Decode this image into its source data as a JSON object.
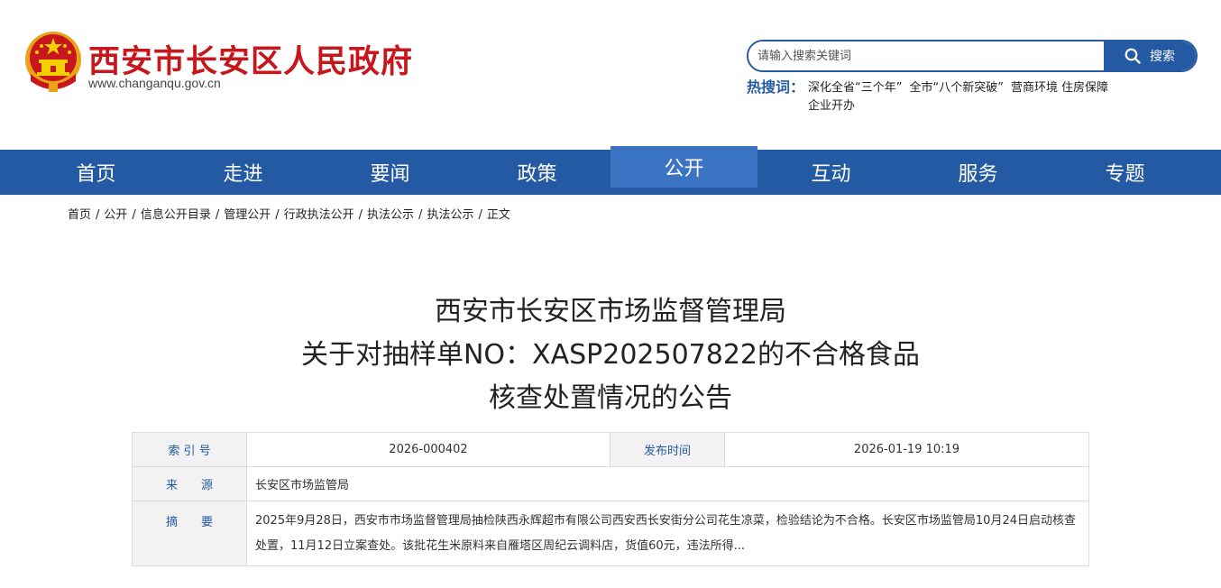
{
  "header": {
    "site_title": "西安市长安区人民政府",
    "site_url": "www.changanqu.gov.cn",
    "colors": {
      "brand_red": "#c8161d",
      "brand_blue": "#2459a3"
    }
  },
  "search": {
    "placeholder": "请输入搜索关键词",
    "button_label": "搜索",
    "icon": "search-icon"
  },
  "hot_search": {
    "label": "热搜词：",
    "links": [
      "深化全省“三个年”",
      "全市“八个新突破”",
      "营商环境",
      "住房保障",
      "企业开办"
    ]
  },
  "nav": {
    "items": [
      "首页",
      "走进",
      "要闻",
      "政策",
      "公开",
      "互动",
      "服务",
      "专题"
    ],
    "active": "公开"
  },
  "breadcrumb": [
    "首页",
    "公开",
    "信息公开目录",
    "管理公开",
    "行政执法公开",
    "执法公示",
    "执法公示",
    "正文"
  ],
  "breadcrumb_sep": "/",
  "document": {
    "title_lines": [
      "西安市长安区市场监督管理局",
      "关于对抽样单NO：XASP202507822的不合格食品",
      "核查处置情况的公告"
    ],
    "info": {
      "index_label": "索 引 号",
      "index_value": "2026-000402",
      "date_label": "发布时间",
      "date_value": "2026-01-19 10:19",
      "source_label": "来　　源",
      "source_value": "长安区市场监管局",
      "summary_label": "摘　　要",
      "summary_value": "2025年9月28日，西安市市场监督管理局抽检陕西永辉超市有限公司西安西长安街分公司花生凉菜，检验结论为不合格。长安区市场监管局10月24日启动核查处置，11月12日立案查处。该批花生米原料来自雁塔区周纪云调料店，货值60元，违法所得..."
    }
  }
}
